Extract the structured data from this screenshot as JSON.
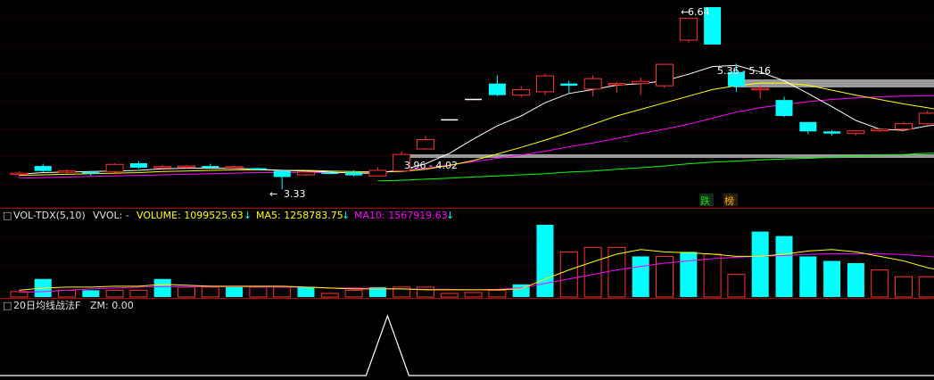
{
  "price_annotations": {
    "high": "6.64",
    "low": "3.33",
    "range_upper": "5.36 - 5.16",
    "range_lower": "3.96 - 4.02"
  },
  "signals": {
    "fall": "跌",
    "rank": "榜"
  },
  "volume_panel": {
    "indicator": "VOL-TDX(5,10)",
    "vvol": "VVOL: -",
    "volume": "VOLUME: 1099525.63",
    "ma5": "MA5: 1258783.75",
    "ma10": "MA10: 1567919.63",
    "arrow": "↓"
  },
  "zm_panel": {
    "indicator": "20日均线战法F",
    "zm": "ZM: 0.00"
  },
  "colors": {
    "up": "#ff3232",
    "down": "#00ffff",
    "ma_white": "#ffffff",
    "ma_yellow": "#ffff00",
    "ma_magenta": "#ff00ff",
    "ma_green": "#00ff00",
    "volume_text": "#ffff00",
    "ma5_text": "#ffff00",
    "ma10_text": "#ff00ff"
  },
  "chart_data": {
    "type": "candlestick",
    "candles": [
      {
        "o": 3.62,
        "c": 3.62,
        "h": 3.65,
        "l": 3.55
      },
      {
        "o": 3.75,
        "c": 3.66,
        "h": 3.79,
        "l": 3.63
      },
      {
        "o": 3.66,
        "c": 3.66,
        "h": 3.69,
        "l": 3.61
      },
      {
        "o": 3.64,
        "c": 3.61,
        "h": 3.66,
        "l": 3.57
      },
      {
        "o": 3.65,
        "c": 3.78,
        "h": 3.8,
        "l": 3.63
      },
      {
        "o": 3.8,
        "c": 3.72,
        "h": 3.84,
        "l": 3.7
      },
      {
        "o": 3.72,
        "c": 3.74,
        "h": 3.77,
        "l": 3.7
      },
      {
        "o": 3.73,
        "c": 3.75,
        "h": 3.77,
        "l": 3.71
      },
      {
        "o": 3.75,
        "c": 3.72,
        "h": 3.79,
        "l": 3.7
      },
      {
        "o": 3.72,
        "c": 3.74,
        "h": 3.75,
        "l": 3.7
      },
      {
        "o": 3.71,
        "c": 3.69,
        "h": 3.72,
        "l": 3.67
      },
      {
        "o": 3.66,
        "c": 3.55,
        "h": 3.69,
        "l": 3.33
      },
      {
        "o": 3.59,
        "c": 3.64,
        "h": 3.66,
        "l": 3.57
      },
      {
        "o": 3.63,
        "c": 3.62,
        "h": 3.66,
        "l": 3.6
      },
      {
        "o": 3.64,
        "c": 3.58,
        "h": 3.67,
        "l": 3.56
      },
      {
        "o": 3.57,
        "c": 3.67,
        "h": 3.73,
        "l": 3.56
      },
      {
        "o": 3.66,
        "c": 3.96,
        "h": 4.02,
        "l": 3.64
      },
      {
        "o": 4.06,
        "c": 4.23,
        "h": 4.3,
        "l": 4.04
      },
      {
        "o": 4.59,
        "c": 4.59,
        "h": 4.59,
        "l": 4.59
      },
      {
        "o": 4.96,
        "c": 4.96,
        "h": 4.96,
        "l": 4.96
      },
      {
        "o": 5.25,
        "c": 5.04,
        "h": 5.4,
        "l": 5.02
      },
      {
        "o": 5.04,
        "c": 5.14,
        "h": 5.2,
        "l": 5.0
      },
      {
        "o": 5.1,
        "c": 5.39,
        "h": 5.43,
        "l": 5.04
      },
      {
        "o": 5.25,
        "c": 5.21,
        "h": 5.3,
        "l": 5.08
      },
      {
        "o": 5.15,
        "c": 5.34,
        "h": 5.4,
        "l": 5.02
      },
      {
        "o": 5.25,
        "c": 5.25,
        "h": 5.28,
        "l": 5.09
      },
      {
        "o": 5.25,
        "c": 5.29,
        "h": 5.36,
        "l": 5.04
      },
      {
        "o": 5.21,
        "c": 5.6,
        "h": 5.6,
        "l": 5.17
      },
      {
        "o": 6.04,
        "c": 6.44,
        "h": 6.44,
        "l": 6.0
      },
      {
        "o": 6.64,
        "c": 5.96,
        "h": 6.64,
        "l": 5.96
      },
      {
        "o": 5.46,
        "c": 5.2,
        "h": 5.61,
        "l": 5.1
      },
      {
        "o": 5.16,
        "c": 5.16,
        "h": 5.21,
        "l": 4.98
      },
      {
        "o": 4.95,
        "c": 4.66,
        "h": 5.01,
        "l": 4.64
      },
      {
        "o": 4.55,
        "c": 4.38,
        "h": 4.55,
        "l": 4.33
      },
      {
        "o": 4.38,
        "c": 4.34,
        "h": 4.4,
        "l": 4.3
      },
      {
        "o": 4.34,
        "c": 4.39,
        "h": 4.4,
        "l": 4.31
      },
      {
        "o": 4.39,
        "c": 4.42,
        "h": 4.44,
        "l": 4.37
      },
      {
        "o": 4.42,
        "c": 4.52,
        "h": 4.55,
        "l": 4.38
      },
      {
        "o": 4.52,
        "c": 4.71,
        "h": 4.76,
        "l": 4.48
      },
      {
        "o": 4.72,
        "c": 4.64,
        "h": 4.74,
        "l": 4.6
      }
    ],
    "ma_white": [
      3.6,
      3.63,
      3.64,
      3.65,
      3.66,
      3.67,
      3.7,
      3.71,
      3.71,
      3.71,
      3.69,
      3.67,
      3.66,
      3.64,
      3.62,
      3.62,
      3.68,
      3.79,
      3.98,
      4.24,
      4.48,
      4.66,
      4.9,
      5.07,
      5.14,
      5.22,
      5.25,
      5.3,
      5.42,
      5.56,
      5.58,
      5.46,
      5.3,
      5.07,
      4.83,
      4.58,
      4.42,
      4.4,
      4.48,
      4.53
    ],
    "ma_yellow": [
      3.58,
      3.59,
      3.6,
      3.61,
      3.62,
      3.63,
      3.65,
      3.66,
      3.67,
      3.68,
      3.68,
      3.67,
      3.67,
      3.66,
      3.65,
      3.64,
      3.65,
      3.69,
      3.76,
      3.85,
      3.97,
      4.09,
      4.22,
      4.36,
      4.51,
      4.66,
      4.78,
      4.9,
      5.02,
      5.14,
      5.21,
      5.26,
      5.26,
      5.22,
      5.13,
      5.04,
      4.96,
      4.88,
      4.81,
      4.73
    ],
    "ma_magenta": [
      3.53,
      3.54,
      3.55,
      3.56,
      3.57,
      3.58,
      3.59,
      3.6,
      3.61,
      3.62,
      3.63,
      3.63,
      3.63,
      3.63,
      3.63,
      3.64,
      3.66,
      3.71,
      3.77,
      3.83,
      3.89,
      3.95,
      4.02,
      4.1,
      4.17,
      4.25,
      4.34,
      4.42,
      4.51,
      4.62,
      4.73,
      4.81,
      4.87,
      4.92,
      4.96,
      4.99,
      5.01,
      5.02,
      5.03,
      5.03
    ],
    "ma_green": [
      null,
      null,
      null,
      null,
      null,
      null,
      null,
      null,
      null,
      null,
      null,
      null,
      null,
      null,
      null,
      3.48,
      3.49,
      3.51,
      3.53,
      3.55,
      3.57,
      3.59,
      3.61,
      3.64,
      3.66,
      3.69,
      3.72,
      3.75,
      3.79,
      3.82,
      3.84,
      3.86,
      3.88,
      3.89,
      3.91,
      3.93,
      3.95,
      3.96,
      3.98,
      3.99
    ],
    "volume": [
      12,
      40,
      15,
      15,
      15,
      15,
      40,
      22,
      22,
      22,
      22,
      22,
      22,
      8,
      15,
      22,
      22,
      22,
      8,
      10,
      15,
      28,
      160,
      100,
      110,
      110,
      90,
      90,
      100,
      95,
      50,
      145,
      135,
      90,
      80,
      75,
      60,
      45,
      45,
      42
    ],
    "volume_up": [
      true,
      false,
      true,
      false,
      true,
      true,
      false,
      true,
      true,
      false,
      true,
      true,
      false,
      true,
      true,
      false,
      true,
      true,
      true,
      true,
      true,
      false,
      false,
      true,
      true,
      true,
      false,
      true,
      false,
      true,
      true,
      false,
      false,
      false,
      false,
      false,
      true,
      true,
      true,
      false
    ],
    "vol_ma5": [
      15,
      20,
      22,
      22,
      24,
      24,
      28,
      26,
      24,
      24,
      24,
      24,
      22,
      20,
      18,
      18,
      18,
      16,
      16,
      16,
      16,
      18,
      40,
      60,
      78,
      95,
      105,
      100,
      98,
      95,
      90,
      90,
      95,
      102,
      105,
      100,
      90,
      80,
      65,
      55
    ],
    "vol_ma10": [
      10,
      12,
      15,
      18,
      20,
      22,
      23,
      23,
      23,
      23,
      23,
      22,
      22,
      20,
      20,
      19,
      18,
      17,
      17,
      16,
      17,
      20,
      30,
      40,
      50,
      60,
      68,
      75,
      80,
      85,
      88,
      90,
      92,
      94,
      96,
      96,
      96,
      94,
      90,
      86
    ],
    "zm": [
      0,
      0,
      0,
      0,
      0,
      0,
      0,
      0,
      0,
      0,
      0,
      0,
      0,
      0,
      0,
      0,
      0,
      0,
      0,
      0,
      0,
      0,
      0,
      0,
      0,
      0,
      0,
      0,
      0,
      0,
      0,
      0,
      0,
      0,
      0,
      0,
      0,
      0,
      0,
      0
    ],
    "zm_spike": {
      "index": 15,
      "value": 1
    },
    "support_levels": [
      {
        "label": "5.36 - 5.16",
        "from": 30
      },
      {
        "label": "3.96 - 4.02",
        "from": 16
      }
    ]
  }
}
